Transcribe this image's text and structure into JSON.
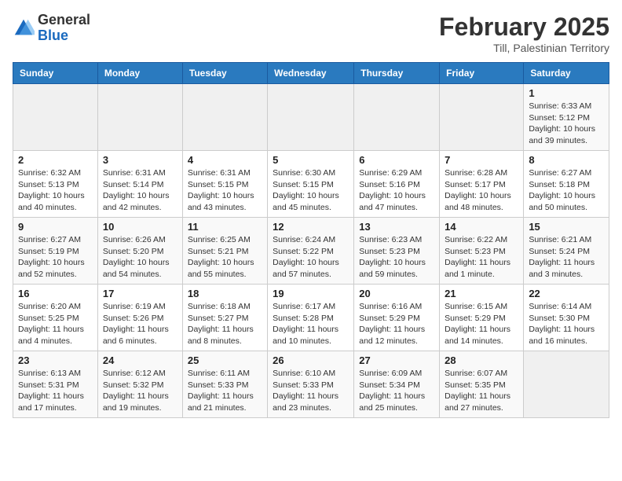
{
  "header": {
    "logo_general": "General",
    "logo_blue": "Blue",
    "main_title": "February 2025",
    "sub_title": "Till, Palestinian Territory"
  },
  "weekdays": [
    "Sunday",
    "Monday",
    "Tuesday",
    "Wednesday",
    "Thursday",
    "Friday",
    "Saturday"
  ],
  "weeks": [
    [
      {
        "day": "",
        "info": ""
      },
      {
        "day": "",
        "info": ""
      },
      {
        "day": "",
        "info": ""
      },
      {
        "day": "",
        "info": ""
      },
      {
        "day": "",
        "info": ""
      },
      {
        "day": "",
        "info": ""
      },
      {
        "day": "1",
        "info": "Sunrise: 6:33 AM\nSunset: 5:12 PM\nDaylight: 10 hours\nand 39 minutes."
      }
    ],
    [
      {
        "day": "2",
        "info": "Sunrise: 6:32 AM\nSunset: 5:13 PM\nDaylight: 10 hours\nand 40 minutes."
      },
      {
        "day": "3",
        "info": "Sunrise: 6:31 AM\nSunset: 5:14 PM\nDaylight: 10 hours\nand 42 minutes."
      },
      {
        "day": "4",
        "info": "Sunrise: 6:31 AM\nSunset: 5:15 PM\nDaylight: 10 hours\nand 43 minutes."
      },
      {
        "day": "5",
        "info": "Sunrise: 6:30 AM\nSunset: 5:15 PM\nDaylight: 10 hours\nand 45 minutes."
      },
      {
        "day": "6",
        "info": "Sunrise: 6:29 AM\nSunset: 5:16 PM\nDaylight: 10 hours\nand 47 minutes."
      },
      {
        "day": "7",
        "info": "Sunrise: 6:28 AM\nSunset: 5:17 PM\nDaylight: 10 hours\nand 48 minutes."
      },
      {
        "day": "8",
        "info": "Sunrise: 6:27 AM\nSunset: 5:18 PM\nDaylight: 10 hours\nand 50 minutes."
      }
    ],
    [
      {
        "day": "9",
        "info": "Sunrise: 6:27 AM\nSunset: 5:19 PM\nDaylight: 10 hours\nand 52 minutes."
      },
      {
        "day": "10",
        "info": "Sunrise: 6:26 AM\nSunset: 5:20 PM\nDaylight: 10 hours\nand 54 minutes."
      },
      {
        "day": "11",
        "info": "Sunrise: 6:25 AM\nSunset: 5:21 PM\nDaylight: 10 hours\nand 55 minutes."
      },
      {
        "day": "12",
        "info": "Sunrise: 6:24 AM\nSunset: 5:22 PM\nDaylight: 10 hours\nand 57 minutes."
      },
      {
        "day": "13",
        "info": "Sunrise: 6:23 AM\nSunset: 5:23 PM\nDaylight: 10 hours\nand 59 minutes."
      },
      {
        "day": "14",
        "info": "Sunrise: 6:22 AM\nSunset: 5:23 PM\nDaylight: 11 hours\nand 1 minute."
      },
      {
        "day": "15",
        "info": "Sunrise: 6:21 AM\nSunset: 5:24 PM\nDaylight: 11 hours\nand 3 minutes."
      }
    ],
    [
      {
        "day": "16",
        "info": "Sunrise: 6:20 AM\nSunset: 5:25 PM\nDaylight: 11 hours\nand 4 minutes."
      },
      {
        "day": "17",
        "info": "Sunrise: 6:19 AM\nSunset: 5:26 PM\nDaylight: 11 hours\nand 6 minutes."
      },
      {
        "day": "18",
        "info": "Sunrise: 6:18 AM\nSunset: 5:27 PM\nDaylight: 11 hours\nand 8 minutes."
      },
      {
        "day": "19",
        "info": "Sunrise: 6:17 AM\nSunset: 5:28 PM\nDaylight: 11 hours\nand 10 minutes."
      },
      {
        "day": "20",
        "info": "Sunrise: 6:16 AM\nSunset: 5:29 PM\nDaylight: 11 hours\nand 12 minutes."
      },
      {
        "day": "21",
        "info": "Sunrise: 6:15 AM\nSunset: 5:29 PM\nDaylight: 11 hours\nand 14 minutes."
      },
      {
        "day": "22",
        "info": "Sunrise: 6:14 AM\nSunset: 5:30 PM\nDaylight: 11 hours\nand 16 minutes."
      }
    ],
    [
      {
        "day": "23",
        "info": "Sunrise: 6:13 AM\nSunset: 5:31 PM\nDaylight: 11 hours\nand 17 minutes."
      },
      {
        "day": "24",
        "info": "Sunrise: 6:12 AM\nSunset: 5:32 PM\nDaylight: 11 hours\nand 19 minutes."
      },
      {
        "day": "25",
        "info": "Sunrise: 6:11 AM\nSunset: 5:33 PM\nDaylight: 11 hours\nand 21 minutes."
      },
      {
        "day": "26",
        "info": "Sunrise: 6:10 AM\nSunset: 5:33 PM\nDaylight: 11 hours\nand 23 minutes."
      },
      {
        "day": "27",
        "info": "Sunrise: 6:09 AM\nSunset: 5:34 PM\nDaylight: 11 hours\nand 25 minutes."
      },
      {
        "day": "28",
        "info": "Sunrise: 6:07 AM\nSunset: 5:35 PM\nDaylight: 11 hours\nand 27 minutes."
      },
      {
        "day": "",
        "info": ""
      }
    ]
  ]
}
